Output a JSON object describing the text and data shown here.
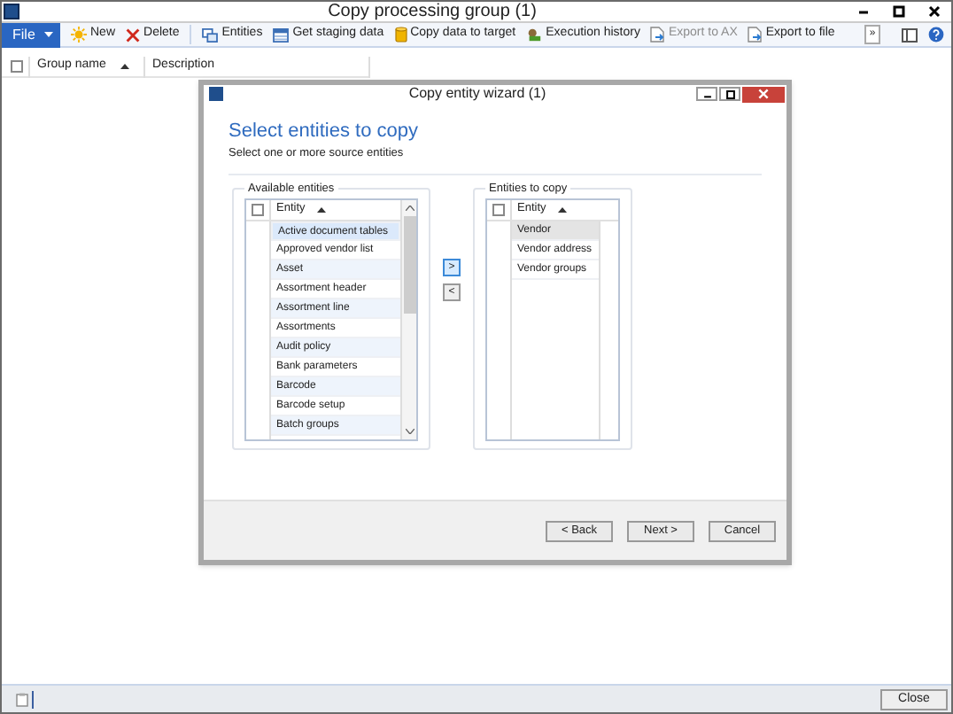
{
  "window": {
    "title": "Copy processing group (1)"
  },
  "toolbar": [
    {
      "label": "File",
      "kind": "menu",
      "disabled": false
    },
    {
      "label": "New",
      "kind": "new",
      "disabled": false
    },
    {
      "label": "Delete",
      "kind": "delete",
      "disabled": false
    },
    {
      "label": "Entities",
      "kind": "entities",
      "disabled": false
    },
    {
      "label": "Get staging data",
      "kind": "staging",
      "disabled": false
    },
    {
      "label": "Copy data to target",
      "kind": "copy",
      "disabled": false
    },
    {
      "label": "Execution history",
      "kind": "history",
      "disabled": false
    },
    {
      "label": "Export to AX",
      "kind": "export",
      "disabled": true
    },
    {
      "label": "Export to file",
      "kind": "export",
      "disabled": false
    },
    {
      "label": "»",
      "kind": "more",
      "disabled": false
    }
  ],
  "grid": {
    "select_all_checked": false,
    "columns": [
      {
        "label": "Group name",
        "sorted": true
      },
      {
        "label": "Description",
        "sorted": false
      }
    ]
  },
  "dialog": {
    "title": "Copy entity wizard (1)",
    "heading": "Select entities to copy",
    "subtitle": "Select one or more source entities",
    "available": {
      "label": "Available entities",
      "column": "Entity",
      "select_all_checked": false,
      "rows": [
        {
          "text": "Active document tables",
          "selected": true
        },
        {
          "text": "Approved vendor list",
          "selected": false
        },
        {
          "text": "Asset",
          "selected": false
        },
        {
          "text": "Assortment header",
          "selected": false
        },
        {
          "text": "Assortment line",
          "selected": false
        },
        {
          "text": "Assortments",
          "selected": false
        },
        {
          "text": "Audit policy",
          "selected": false
        },
        {
          "text": "Bank parameters",
          "selected": false
        },
        {
          "text": "Barcode",
          "selected": false
        },
        {
          "text": "Barcode setup",
          "selected": false
        },
        {
          "text": "Batch groups",
          "selected": false
        }
      ]
    },
    "move_buttons": [
      ">",
      "<"
    ],
    "to_copy": {
      "label": "Entities to copy",
      "column": "Entity",
      "select_all_checked": false,
      "rows": [
        {
          "text": "Vendor",
          "selected": true
        },
        {
          "text": "Vendor address",
          "selected": false
        },
        {
          "text": "Vendor groups",
          "selected": false
        }
      ]
    },
    "buttons": [
      "< Back",
      "Next >",
      "Cancel"
    ]
  },
  "close_button": "Close"
}
